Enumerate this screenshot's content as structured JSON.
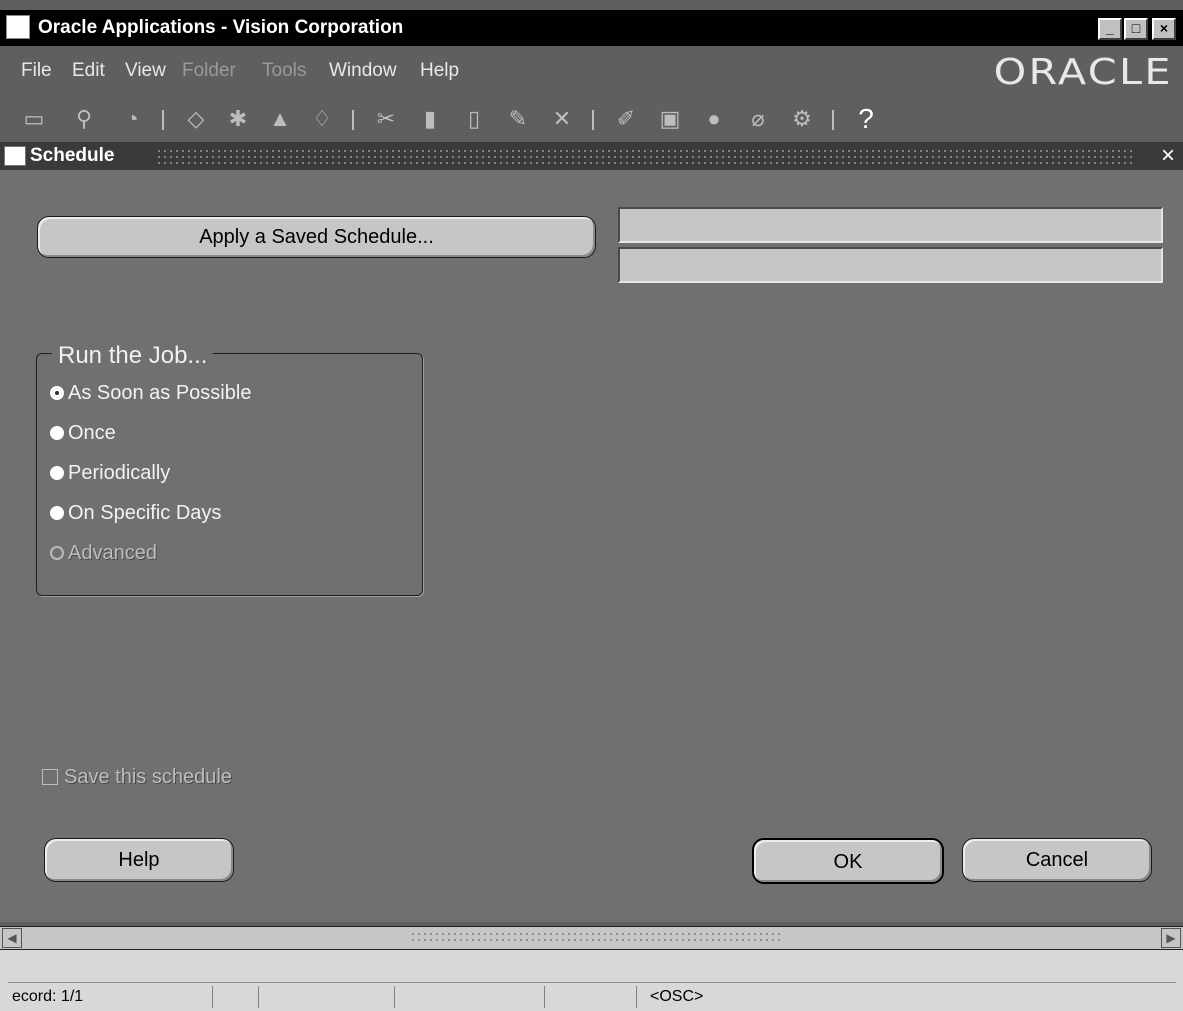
{
  "window": {
    "title": "Oracle Applications - Vision Corporation",
    "minimize": "_",
    "maximize": "□",
    "close": "×"
  },
  "menubar": {
    "items": [
      {
        "label": "File",
        "enabled": true
      },
      {
        "label": "Edit",
        "enabled": true
      },
      {
        "label": "View",
        "enabled": true
      },
      {
        "label": "Folder",
        "enabled": false
      },
      {
        "label": "Tools",
        "enabled": false
      },
      {
        "label": "Window",
        "enabled": true
      },
      {
        "label": "Help",
        "enabled": true
      }
    ],
    "brand": "ORACLE"
  },
  "toolbar": {
    "icons": [
      "new-record-icon",
      "find-icon",
      "navigator-icon",
      "save-icon",
      "next-step-icon",
      "print-icon",
      "close-form-icon",
      "cut-icon",
      "copy-icon",
      "paste-icon",
      "new-record-2-icon",
      "delete-record-icon",
      "edit-field-icon",
      "zoom-icon",
      "translations-icon",
      "attachments-icon",
      "folder-tools-icon",
      "help-icon"
    ],
    "help_glyph": "?"
  },
  "dialog": {
    "title": "Schedule",
    "close": "×",
    "apply_button": "Apply a Saved Schedule...",
    "run_group_title": "Run the Job...",
    "options": [
      {
        "label": "As Soon as Possible",
        "selected": true,
        "enabled": true
      },
      {
        "label": "Once",
        "selected": false,
        "enabled": true
      },
      {
        "label": "Periodically",
        "selected": false,
        "enabled": true
      },
      {
        "label": "On Specific Days",
        "selected": false,
        "enabled": true
      },
      {
        "label": "Advanced",
        "selected": false,
        "enabled": false
      }
    ],
    "save_checkbox": "Save this schedule",
    "help_button": "Help",
    "ok_button": "OK",
    "cancel_button": "Cancel"
  },
  "statusbar": {
    "record": "ecord: 1/1",
    "osc": "<OSC>"
  }
}
